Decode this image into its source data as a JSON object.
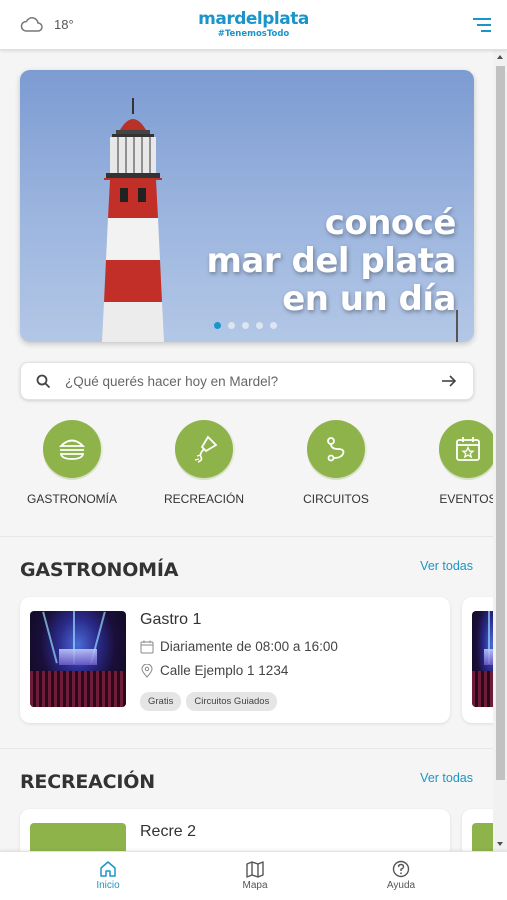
{
  "header": {
    "temperature": "18°",
    "weather_icon": "cloud-icon",
    "brand_name": "mardelplata",
    "brand_tagline": "#TenemosTodo",
    "menu_icon": "hamburger-icon"
  },
  "hero": {
    "title_line1": "conocé",
    "title_line2": "mar del plata",
    "title_line3": "en un día",
    "slides_count": 5,
    "active_slide": 1
  },
  "search": {
    "placeholder": "¿Qué querés hacer hoy en Mardel?"
  },
  "categories": [
    {
      "label": "GASTRONOMÍA",
      "icon": "burger-icon"
    },
    {
      "label": "RECREACIÓN",
      "icon": "kite-icon"
    },
    {
      "label": "CIRCUITOS",
      "icon": "route-icon"
    },
    {
      "label": "EVENTOS",
      "icon": "calendar-icon"
    }
  ],
  "gastronomia": {
    "title": "GASTRONOMÍA",
    "see_all": "Ver todas",
    "card": {
      "title": "Gastro 1",
      "schedule": "Diariamente de 08:00 a 16:00",
      "address": "Calle Ejemplo 1 1234",
      "tags": [
        "Gratis",
        "Circuitos Guiados"
      ]
    }
  },
  "recreacion": {
    "title": "RECREACIÓN",
    "see_all": "Ver todas",
    "card": {
      "title": "Recre 2"
    }
  },
  "nav": {
    "home": "Inicio",
    "map": "Mapa",
    "help": "Ayuda"
  },
  "colors": {
    "brand_blue": "#1b95c9",
    "category_green": "#8fb34b"
  }
}
